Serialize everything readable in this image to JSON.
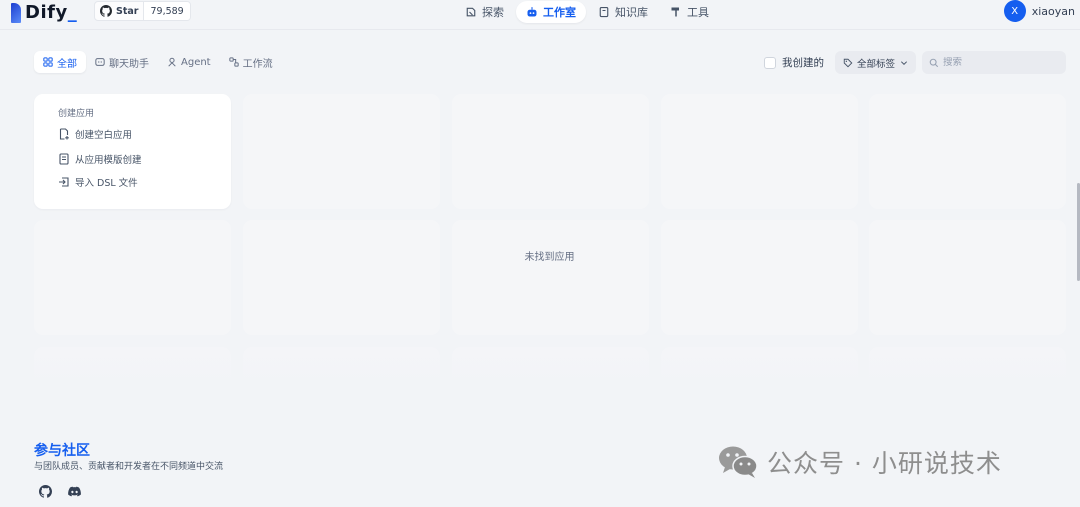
{
  "header": {
    "logo_text": "Dify",
    "logo_suffix": "_",
    "github": {
      "star_label": "Star",
      "star_count": "79,589"
    },
    "nav": [
      {
        "label": "探索",
        "icon": "explore-icon"
      },
      {
        "label": "工作室",
        "icon": "robot-icon",
        "active": true
      },
      {
        "label": "知识库",
        "icon": "book-icon"
      },
      {
        "label": "工具",
        "icon": "hammer-icon"
      }
    ],
    "user": {
      "avatar_initial": "X",
      "name": "xiaoyan"
    }
  },
  "toolbar": {
    "tabs": [
      {
        "label": "全部",
        "active": true
      },
      {
        "label": "聊天助手"
      },
      {
        "label": "Agent"
      },
      {
        "label": "工作流"
      }
    ],
    "mine_label": "我创建的",
    "tag_filter_label": "全部标签",
    "search_placeholder": "搜索"
  },
  "create_card": {
    "title": "创建应用",
    "items": [
      "创建空白应用",
      "从应用模版创建",
      "导入 DSL 文件"
    ]
  },
  "empty_message": "未找到应用",
  "footer": {
    "title": "参与社区",
    "description": "与团队成员、贡献者和开发者在不同频道中交流"
  },
  "watermark": "公众号 · 小研说技术",
  "colors": {
    "accent": "#155eef",
    "background": "#f2f4f7"
  }
}
